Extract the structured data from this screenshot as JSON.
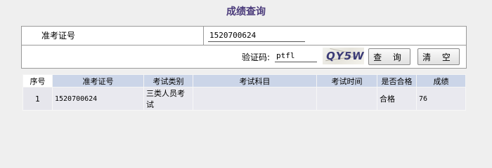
{
  "page": {
    "title": "成绩查询"
  },
  "form": {
    "id_label": "准考证号",
    "id_value": "1520700624",
    "captcha_label": "验证码:",
    "captcha_value": "ptfl",
    "captcha_image_text": "QY5W",
    "query_button": "查 询",
    "clear_button": "清 空"
  },
  "results": {
    "columns": [
      "序号",
      "准考证号",
      "考试类别",
      "考试科目",
      "考试时间",
      "是否合格",
      "成绩"
    ],
    "rows": [
      {
        "index": "1",
        "exam_id": "1520700624",
        "category": "三类人员考试",
        "subject": "",
        "time": "",
        "passed": "合格",
        "score": "76"
      }
    ]
  },
  "colors": {
    "title": "#4a3a7a",
    "header_bg": "#cbd5e8",
    "row_bg": "#e9e9ef"
  }
}
